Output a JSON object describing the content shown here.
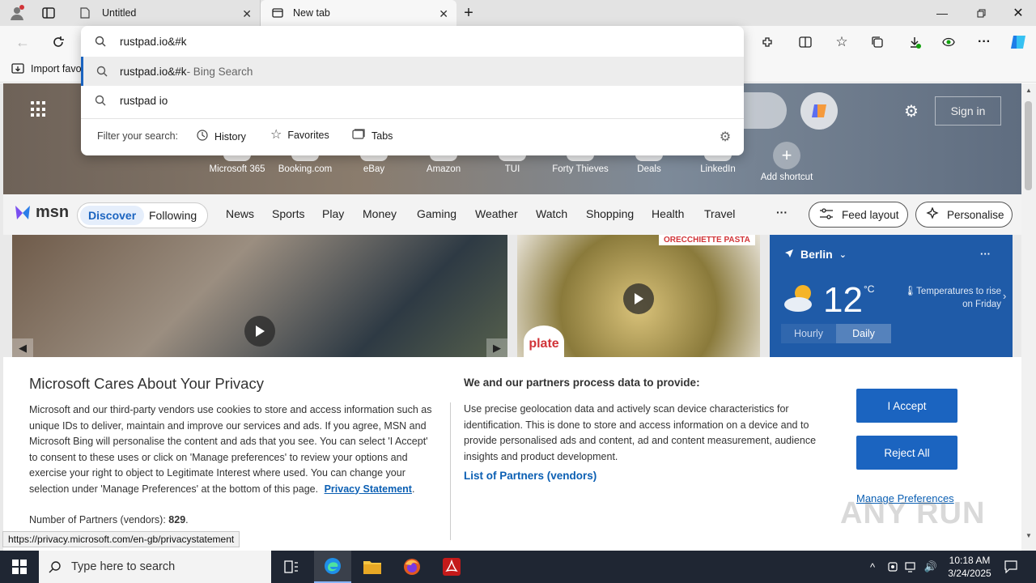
{
  "browser": {
    "tabs": [
      {
        "label": "Untitled"
      },
      {
        "label": "New tab"
      }
    ],
    "favbar": {
      "import_label": "Import favo"
    }
  },
  "omnibox": {
    "query": "rustpad.io&#k",
    "suggestions": [
      {
        "text": "rustpad.io&#k",
        "suffix": " - Bing Search"
      },
      {
        "text": "rustpad io",
        "suffix": ""
      }
    ],
    "filter_label": "Filter your search:",
    "filters": [
      {
        "label": "History"
      },
      {
        "label": "Favorites"
      },
      {
        "label": "Tabs"
      }
    ]
  },
  "newtab": {
    "sign_in": "Sign in",
    "shortcuts": [
      {
        "label": "Microsoft 365"
      },
      {
        "label": "Booking.com"
      },
      {
        "label": "eBay"
      },
      {
        "label": "Amazon"
      },
      {
        "label": "TUI"
      },
      {
        "label": "Forty Thieves"
      },
      {
        "label": "Deals"
      },
      {
        "label": "LinkedIn"
      },
      {
        "label": "Add shortcut"
      }
    ]
  },
  "msn": {
    "logo": "msn",
    "tabs": [
      "Discover",
      "Following"
    ],
    "nav": [
      "News",
      "Sports",
      "Play",
      "Money",
      "Gaming",
      "Weather",
      "Watch",
      "Shopping",
      "Health",
      "Travel"
    ],
    "more": "···",
    "feed_layout": "Feed layout",
    "personalise": "Personalise",
    "card2_banner": "ORECCHIETTE PASTA",
    "card2_brand": "plate",
    "weather": {
      "city": "Berlin",
      "temp": "12",
      "unit": "°C",
      "note": "Temperatures to rise on Friday",
      "tabs": [
        "Hourly",
        "Daily"
      ]
    }
  },
  "privacy": {
    "title": "Microsoft Cares About Your Privacy",
    "body": "Microsoft and our third-party vendors use cookies to store and access information such as unique IDs to deliver, maintain and improve our services and ads. If you agree, MSN and Microsoft Bing will personalise the content and ads that you see. You can select 'I Accept' to consent to these uses or click on 'Manage preferences' to review your options and exercise your right to object to Legitimate Interest where used.  You can change your selection under 'Manage Preferences' at the bottom of this page.",
    "privacy_link": "Privacy Statement",
    "partners_label": "Number of Partners (vendors): ",
    "partners_count": "829",
    "right_title": "We and our partners process data to provide:",
    "right_body": "Use precise geolocation data and actively scan device characteristics for identification. This is done to store and access information on a device and to provide personalised ads and content, ad and content measurement, audience insights and product development.",
    "vendors_link": "List of Partners (vendors)",
    "accept": "I Accept",
    "reject": "Reject All",
    "manage": "Manage Preferences"
  },
  "status_url": "https://privacy.microsoft.com/en-gb/privacystatement",
  "watermark": "ANY RUN",
  "taskbar": {
    "search_placeholder": "Type here to search",
    "time": "10:18 AM",
    "date": "3/24/2025"
  },
  "colors": {
    "accent": "#1b64c0",
    "link": "#0b5fb3",
    "taskbar": "#1f2633",
    "weather_card": "#1f5ba8"
  }
}
